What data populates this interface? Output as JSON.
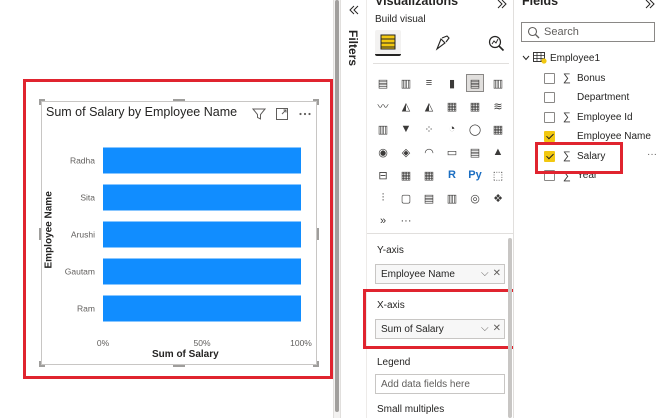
{
  "canvas": {
    "visual": {
      "title": "Sum of Salary by Employee Name",
      "header_icons": [
        "filter-icon",
        "focus-mode-icon",
        "more-options-icon"
      ]
    }
  },
  "chart_data": {
    "type": "bar",
    "orientation": "horizontal",
    "title": "Sum of Salary by Employee Name",
    "xlabel": "Sum of Salary",
    "ylabel": "Employee Name",
    "categories": [
      "Radha",
      "Sita",
      "Arushi",
      "Gautam",
      "Ram"
    ],
    "series": [
      {
        "values": [
          100,
          100,
          100,
          100,
          100
        ]
      }
    ],
    "x_tick_labels": [
      "0%",
      "50%",
      "100%"
    ],
    "xlim": [
      0,
      100
    ],
    "bar_color": "#118dff",
    "grid": false,
    "legend": "none"
  },
  "visualizations": {
    "title": "Visualizations",
    "filters_label": "Filters",
    "build_visual_label": "Build visual",
    "more_glyph": "···",
    "wells": {
      "y_axis_label": "Y-axis",
      "y_axis_value": "Employee Name",
      "x_axis_label": "X-axis",
      "x_axis_value": "Sum of Salary",
      "legend_label": "Legend",
      "legend_placeholder": "Add data fields here",
      "small_multiples_label": "Small multiples"
    }
  },
  "fields": {
    "title": "Fields",
    "search_placeholder": "Search",
    "table_name": "Employee1",
    "more_glyph": "···",
    "items": [
      {
        "label": "Bonus",
        "sigma": "∑",
        "checked": false
      },
      {
        "label": "Department",
        "sigma": "",
        "checked": false
      },
      {
        "label": "Employee Id",
        "sigma": "∑",
        "checked": false
      },
      {
        "label": "Employee Name",
        "sigma": "",
        "checked": true
      },
      {
        "label": "Salary",
        "sigma": "∑",
        "checked": true
      },
      {
        "label": "Year",
        "sigma": "∑",
        "checked": false
      }
    ]
  },
  "colors": {
    "accent": "#e0242f",
    "bar": "#118dff",
    "checkbox": "#f2c811"
  }
}
